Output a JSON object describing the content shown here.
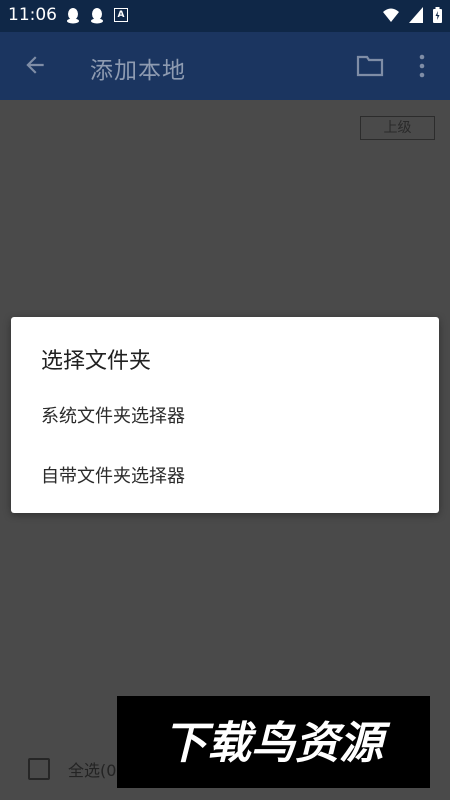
{
  "status_bar": {
    "time": "11:06"
  },
  "app_bar": {
    "title": "添加本地"
  },
  "content": {
    "up_button_label": "上级",
    "select_all_label": "全选(0"
  },
  "dialog": {
    "title": "选择文件夹",
    "options": [
      "系统文件夹选择器",
      "自带文件夹选择器"
    ]
  },
  "watermark": {
    "text": "下载鸟资源"
  },
  "colors": {
    "status_bar_bg": "#0f2747",
    "app_bar_bg": "#1b3560",
    "overlay": "#4a4a4a",
    "dialog_bg": "#ffffff"
  }
}
